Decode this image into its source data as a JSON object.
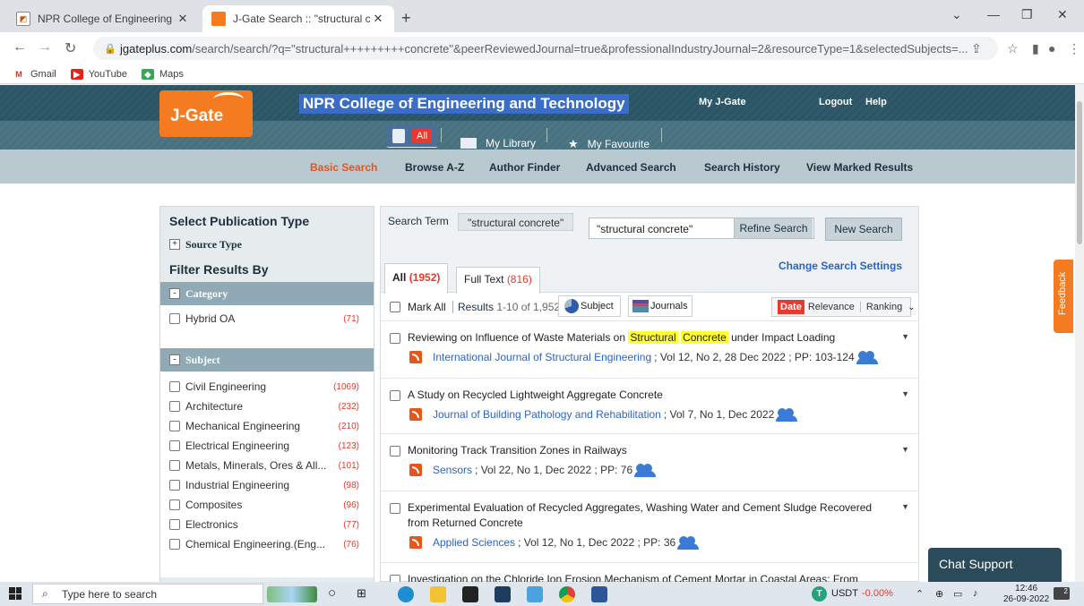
{
  "browser": {
    "tabs": [
      {
        "title": "NPR College of Engineering & Te",
        "active": false
      },
      {
        "title": "J-Gate Search :: \"structural concr",
        "active": true
      }
    ],
    "url_host": "jgateplus.com",
    "url_path": "/search/search/?q=\"structural+++++++++concrete\"&peerReviewedJournal=true&professionalIndustryJournal=2&resourceType=1&selectedSubjects=...",
    "bookmarks": [
      "Gmail",
      "YouTube",
      "Maps"
    ]
  },
  "header": {
    "logo": "J-Gate",
    "college": "NPR College of Engineering and Technology",
    "my_jgate": "My J-Gate",
    "logout": "Logout",
    "help": "Help"
  },
  "nav2": {
    "all": "All",
    "my_library": "My Library",
    "my_favourite": "My Favourite"
  },
  "nav3": {
    "links": [
      "Basic Search",
      "Browse A-Z",
      "Author Finder",
      "Advanced Search",
      "Search History",
      "View Marked Results"
    ]
  },
  "sidebar": {
    "select_pub_type": "Select Publication Type",
    "source_type": "Source Type",
    "filter_results_by": "Filter Results By",
    "category_label": "Category",
    "category_items": [
      {
        "label": "Hybrid OA",
        "count": "(71)"
      }
    ],
    "subject_label": "Subject",
    "subject_items": [
      {
        "label": "Civil Engineering",
        "count": "(1069)"
      },
      {
        "label": "Architecture",
        "count": "(232)"
      },
      {
        "label": "Mechanical Engineering",
        "count": "(210)"
      },
      {
        "label": "Electrical Engineering",
        "count": "(123)"
      },
      {
        "label": "Metals, Minerals, Ores & All...",
        "count": "(101)"
      },
      {
        "label": "Industrial Engineering",
        "count": "(98)"
      },
      {
        "label": "Composites",
        "count": "(96)"
      },
      {
        "label": "Electronics",
        "count": "(77)"
      },
      {
        "label": "Chemical Engineering.(Eng...",
        "count": "(76)"
      }
    ]
  },
  "search": {
    "term_label": "Search Term",
    "term_chip": "\"structural concrete\"",
    "input_value": "\"structural concrete\"",
    "refine": "Refine Search",
    "new_search": "New Search",
    "change_settings": "Change Search Settings",
    "tab_all": "All",
    "tab_all_count": "(1952)",
    "tab_fulltext": "Full Text",
    "tab_fulltext_count": "(816)",
    "mark_all": "Mark All",
    "results_label": "Results",
    "results_range": "1-10 of 1,952",
    "subject_btn": "Subject",
    "journals_btn": "Journals",
    "sort_date": "Date",
    "sort_relevance": "Relevance",
    "sort_ranking": "Ranking"
  },
  "results": [
    {
      "pre": "Reviewing on Influence of Waste Materials on",
      "hl1": "Structural",
      "hl2": "Concrete",
      "post": "under Impact Loading",
      "journal": "International Journal of Structural Engineering",
      "meta": "; Vol 12, No 2, 28 Dec 2022 ; PP: 103-124"
    },
    {
      "title": "A Study on Recycled Lightweight Aggregate Concrete",
      "journal": "Journal of Building Pathology and Rehabilitation",
      "meta": "; Vol 7, No 1, Dec 2022"
    },
    {
      "title": "Monitoring Track Transition Zones in Railways",
      "journal": "Sensors",
      "meta": "; Vol 22, No 1, Dec 2022 ; PP: 76"
    },
    {
      "title": "Experimental Evaluation of Recycled Aggregates, Washing Water and Cement Sludge Recovered from Returned Concrete",
      "journal": "Applied Sciences",
      "meta": "; Vol 12, No 1, Dec 2022 ; PP: 36"
    },
    {
      "title": "Investigation on the Chloride Ion Erosion Mechanism of Cement Mortar in Coastal Areas: From"
    }
  ],
  "widgets": {
    "feedback": "Feedback",
    "chat_support": "Chat Support"
  },
  "taskbar": {
    "search_placeholder": "Type here to search",
    "usdt_label": "USDT",
    "usdt_change": "-0.00%",
    "time": "12:46",
    "date": "26-09-2022",
    "notif_count": "2"
  }
}
